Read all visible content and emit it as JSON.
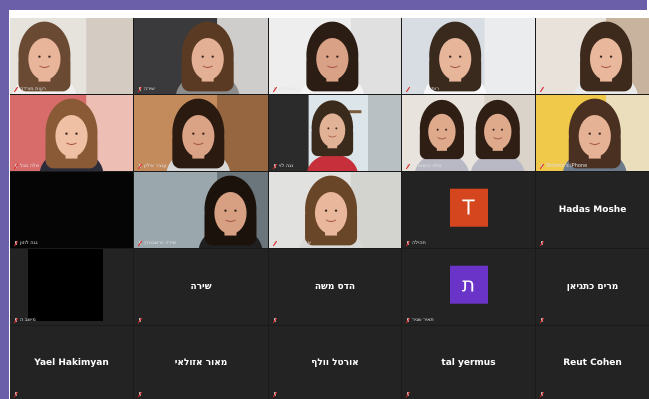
{
  "window": {
    "frame_color": "#6a5fa8",
    "grid_bg": "#1a1a1a"
  },
  "participants": [
    {
      "row": 0,
      "col": 0,
      "name": "רעות מורדה",
      "type": "video",
      "scene": "light-wall-girl"
    },
    {
      "row": 0,
      "col": 1,
      "name": "שירה",
      "type": "video",
      "scene": "dark-room-girl"
    },
    {
      "row": 0,
      "col": 2,
      "name": "אביה פז",
      "type": "video",
      "scene": "curly-hair-girl"
    },
    {
      "row": 0,
      "col": 3,
      "name": "רותם שמעוני",
      "type": "video",
      "scene": "smiling-curly-girl"
    },
    {
      "row": 0,
      "col": 4,
      "name": "lbl",
      "type": "video",
      "scene": "striped-shirt-girl"
    },
    {
      "row": 1,
      "col": 0,
      "name": "אלה סגל",
      "type": "video",
      "scene": "pink-wall-girl"
    },
    {
      "row": 1,
      "col": 1,
      "name": "ענבר אילון",
      "type": "video",
      "scene": "warm-room-girl"
    },
    {
      "row": 1,
      "col": 2,
      "name": "נגה לוי",
      "type": "video",
      "scene": "shelf-girl"
    },
    {
      "row": 1,
      "col": 3,
      "name": "סתיו והשארית",
      "type": "video",
      "scene": "two-girls"
    },
    {
      "row": 1,
      "col": 4,
      "name": "Shlomo's iPhone",
      "type": "video",
      "scene": "yellow-wall-girl"
    },
    {
      "row": 2,
      "col": 0,
      "name": "נגה לוזון",
      "type": "dark",
      "scene": ""
    },
    {
      "row": 2,
      "col": 1,
      "name": "שירה וירשבסקי",
      "type": "video",
      "scene": "living-room-girl"
    },
    {
      "row": 2,
      "col": 2,
      "name": "אליזבט באלאל",
      "type": "video",
      "scene": "grey-wall-girl"
    },
    {
      "row": 2,
      "col": 3,
      "name": "תהילה",
      "type": "avatar",
      "letter": "T",
      "color": "#d5451e"
    },
    {
      "row": 2,
      "col": 4,
      "name": "Hadas Moshe",
      "type": "name"
    },
    {
      "row": 3,
      "col": 0,
      "name": "מישב ה",
      "type": "blackbox"
    },
    {
      "row": 3,
      "col": 1,
      "name": "שירה",
      "type": "name"
    },
    {
      "row": 3,
      "col": 2,
      "name": "הדס משה",
      "type": "name"
    },
    {
      "row": 3,
      "col": 3,
      "name": "תאיר שגיר",
      "type": "avatar",
      "letter": "ת",
      "color": "#6b34c8"
    },
    {
      "row": 3,
      "col": 4,
      "name": "מרים כתגיאן",
      "type": "name"
    },
    {
      "row": 4,
      "col": 0,
      "name": "Yael Hakimyan",
      "type": "name"
    },
    {
      "row": 4,
      "col": 1,
      "name": "מאור אזולאי",
      "type": "name"
    },
    {
      "row": 4,
      "col": 2,
      "name": "אורטל וולף",
      "type": "name"
    },
    {
      "row": 4,
      "col": 3,
      "name": "tal yermus",
      "type": "name"
    },
    {
      "row": 4,
      "col": 4,
      "name": "Reut Cohen",
      "type": "name"
    }
  ]
}
